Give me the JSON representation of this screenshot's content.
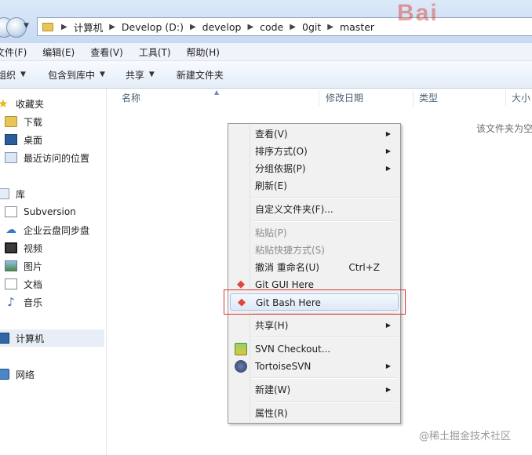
{
  "address_bar": {
    "crumbs": [
      "计算机",
      "Develop (D:)",
      "develop",
      "code",
      "0git",
      "master"
    ]
  },
  "logo_text": "Bai",
  "menubar": {
    "file": "文件(F)",
    "edit": "编辑(E)",
    "view": "查看(V)",
    "tools": "工具(T)",
    "help": "帮助(H)"
  },
  "commandbar": {
    "organize": "组织",
    "include_in_library": "包含到库中",
    "share": "共享",
    "new_folder": "新建文件夹"
  },
  "navpane": {
    "favorites": "收藏夹",
    "downloads": "下载",
    "desktop": "桌面",
    "recent_places": "最近访问的位置",
    "libraries": "库",
    "subversion": "Subversion",
    "cloud_sync": "企业云盘同步盘",
    "videos": "视频",
    "pictures": "图片",
    "documents": "文档",
    "music": "音乐",
    "computer": "计算机",
    "network": "网络"
  },
  "columns": {
    "name": "名称",
    "date_modified": "修改日期",
    "type": "类型",
    "size": "大小"
  },
  "empty_message": "该文件夹为空",
  "context_menu": {
    "view": "查看(V)",
    "sort_by": "排序方式(O)",
    "group_by": "分组依据(P)",
    "refresh": "刷新(E)",
    "customize_folder": "自定义文件夹(F)...",
    "paste": "粘贴(P)",
    "paste_shortcut": "粘贴快捷方式(S)",
    "undo_rename": "撤消 重命名(U)",
    "undo_shortcut": "Ctrl+Z",
    "git_gui": "Git GUI Here",
    "git_bash": "Git Bash Here",
    "share_with": "共享(H)",
    "svn_checkout": "SVN Checkout...",
    "tortoise_svn": "TortoiseSVN",
    "new": "新建(W)",
    "properties": "属性(R)"
  },
  "watermark": "@稀土掘金技术社区"
}
